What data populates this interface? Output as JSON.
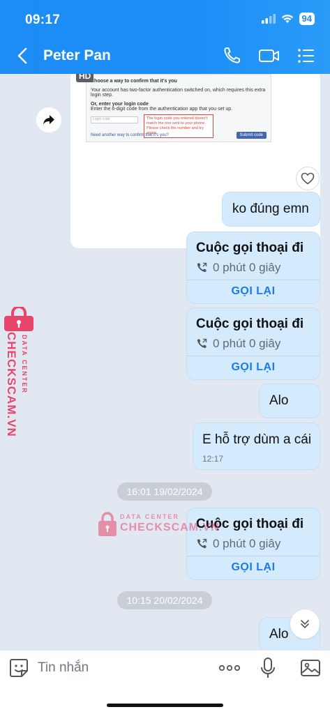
{
  "status_bar": {
    "time": "09:17",
    "battery": "94"
  },
  "header": {
    "title": "Peter Pan"
  },
  "image_message": {
    "badge": "HD",
    "heading": "Choose a way to confirm that it's you",
    "body": "Your account has two-factor authentication switched on, which requires this extra login step.",
    "code_heading": "Or, enter your login code",
    "code_instructions": "Enter the 6-digit code from the authentication app that you set up.",
    "input_placeholder": "Login code",
    "error": "The login code you entered doesn't match the one sent to your phone. Please check the number and try again.",
    "link": "Need another way to confirm that it's you?",
    "submit": "Submit code"
  },
  "messages": {
    "m1": "ko đúng emn",
    "call1": {
      "title": "Cuộc gọi thoại đi",
      "duration": "0 phút 0 giây",
      "action": "GỌI LẠI"
    },
    "call2": {
      "title": "Cuộc gọi thoại đi",
      "duration": "0 phút 0 giây",
      "action": "GỌI LẠI"
    },
    "m2": "Alo",
    "m3": {
      "text": "E hỗ trợ dùm a cái",
      "time": "12:17"
    },
    "date1": "16:01 19/02/2024",
    "call3": {
      "title": "Cuộc gọi thoại đi",
      "duration": "0 phút 0 giây",
      "action": "GỌI LẠI"
    },
    "date2": "10:15 20/02/2024",
    "m4": "Alo"
  },
  "watermark": {
    "top": "DATA CENTER",
    "brand": "CHECKSCAM.VN"
  },
  "input": {
    "placeholder": "Tin nhắn"
  },
  "colors": {
    "header": "#1d8cf5",
    "bubble": "#d4eafd",
    "action": "#1a7be6",
    "watermark": "#e8456b"
  }
}
